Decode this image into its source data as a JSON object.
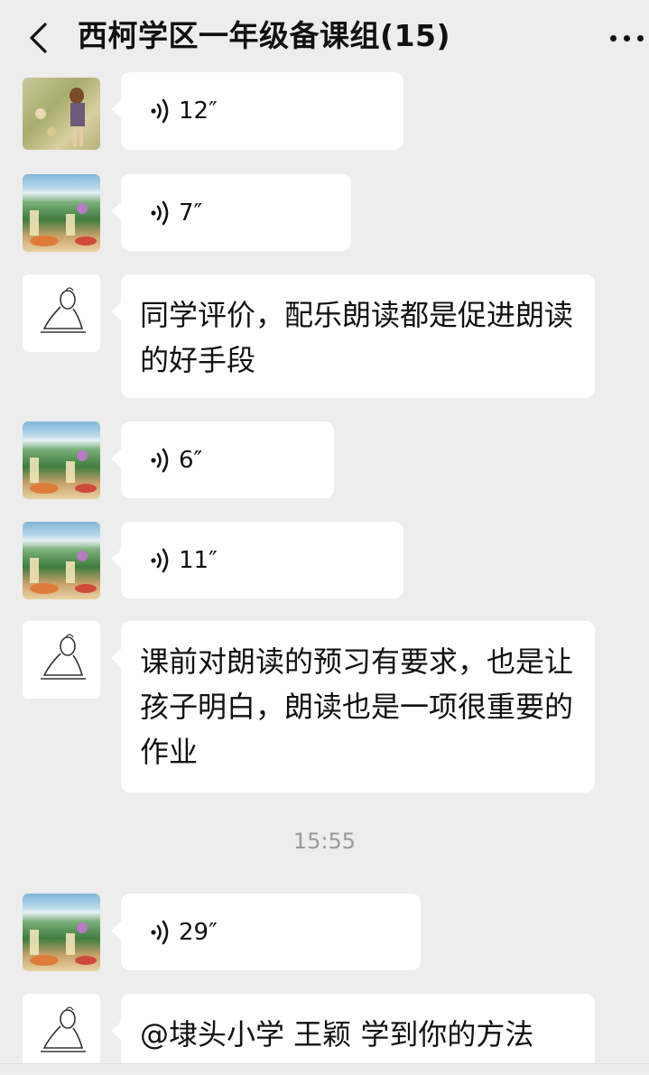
{
  "header": {
    "title": "西柯学区一年级备课组(15)"
  },
  "messages": [
    {
      "type": "voice",
      "duration": "12″",
      "avatar": "girl-photo"
    },
    {
      "type": "voice",
      "duration": "7″",
      "avatar": "scenic-photo"
    },
    {
      "type": "text",
      "text": "同学评价，配乐朗读都是促进朗读的好手段",
      "avatar": "sketch-drawing"
    },
    {
      "type": "voice",
      "duration": "6″",
      "avatar": "scenic-photo"
    },
    {
      "type": "voice",
      "duration": "11″",
      "avatar": "scenic-photo"
    },
    {
      "type": "text",
      "text": "课前对朗读的预习有要求，也是让孩子明白，朗读也是一项很重要的作业",
      "avatar": "sketch-drawing"
    },
    {
      "type": "timestamp",
      "text": "15:55"
    },
    {
      "type": "voice",
      "duration": "29″",
      "avatar": "scenic-photo"
    },
    {
      "type": "text",
      "text": "@埭头小学 王颖  学到你的方法",
      "avatar": "sketch-drawing"
    }
  ],
  "icons": {
    "back": "chevron-left-icon",
    "more": "more-dots-icon",
    "voice": "voice-wave-icon"
  },
  "colors": {
    "background": "#ededed",
    "bubble": "#ffffff",
    "timestamp": "#999999"
  }
}
